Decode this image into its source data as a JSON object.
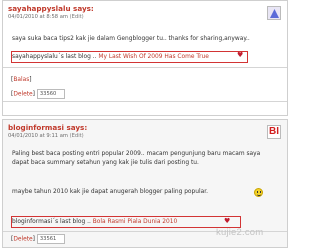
{
  "comments": [
    {
      "author": "sayahappyslalu says:",
      "meta": "04/01/2010 at 8:58 am",
      "edit_label": "(Edit)",
      "body": "saya suka baca tips2 kak jie dalam Gengblogger tu.. thanks for sharing,anyway..",
      "last_blog_prefix": "sayahappyslalu´s last blog .. ",
      "last_blog_link": "My Last Wish Of 2009 Has Come True",
      "reply_label": "Balas",
      "delete_label": "Delete",
      "comment_id": "33560",
      "avatar_icon": "geometric-avatar-icon"
    },
    {
      "author": "bloginformasi says:",
      "meta": "04/01/2010 at 9:11 am",
      "edit_label": "(Edit)",
      "body": "Paling best baca posting entri popular 2009.. macam pengunjung baru macam saya dapat baca summary setahun yang kak jie tulis dari posting tu.",
      "body2": "maybe tahun 2010 kak jie dapat anugerah blogger paling popular.",
      "last_blog_prefix": "bloginformasi´s last blog .. ",
      "last_blog_link": "Bola Rasmi Piala Dunia 2010",
      "delete_label": "Delete",
      "comment_id": "33561",
      "avatar_icon": "bi-logo-avatar-icon",
      "avatar_text": "BI"
    }
  ],
  "watermark": "kujie2.com",
  "colors": {
    "accent": "#c0392b",
    "heart": "#c21c2e"
  }
}
